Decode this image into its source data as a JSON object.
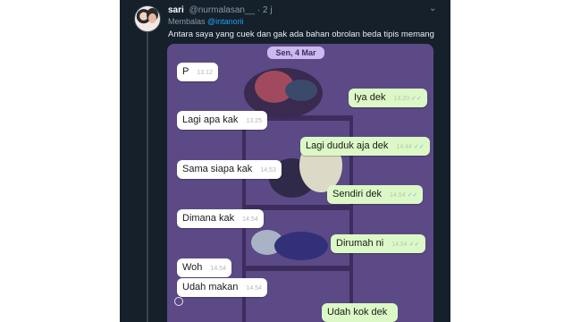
{
  "tweet": {
    "display_name": "sari",
    "handle": "@nurmalasan__",
    "separator": "·",
    "time_ago": "2 j",
    "menu_icon": "chevron-down-icon",
    "reply_prefix": "Membalas",
    "reply_mention": "@intanorii",
    "text": "Antara saya yang cuek dan gak ada bahan obrolan beda tipis memang"
  },
  "chat": {
    "date_label": "Sen, 4 Mar",
    "messages": [
      {
        "side": "in",
        "text": "P",
        "time": "13.12"
      },
      {
        "side": "out",
        "text": "Iya dek",
        "time": "13.20"
      },
      {
        "side": "in",
        "text": "Lagi apa kak",
        "time": "13.25"
      },
      {
        "side": "out",
        "text": "Lagi duduk aja dek",
        "time": "14.44"
      },
      {
        "side": "in",
        "text": "Sama siapa kak",
        "time": "14.53"
      },
      {
        "side": "out",
        "text": "Sendiri dek",
        "time": "14.54"
      },
      {
        "side": "in",
        "text": "Dimana kak",
        "time": "14.54"
      },
      {
        "side": "out",
        "text": "Dirumah ni",
        "time": "14.54"
      },
      {
        "side": "in",
        "text": "Woh",
        "time": "14.54"
      },
      {
        "side": "in",
        "text": "Udah makan",
        "time": "14.54"
      },
      {
        "side": "out",
        "text": "Udah kok dek",
        "time": ""
      }
    ]
  },
  "colors": {
    "tweet_background": "#15202b",
    "mention": "#1da1f2",
    "chat_wallpaper": "#5b4a86",
    "incoming_bubble": "#ffffff",
    "outgoing_bubble": "#dcf8c6"
  }
}
